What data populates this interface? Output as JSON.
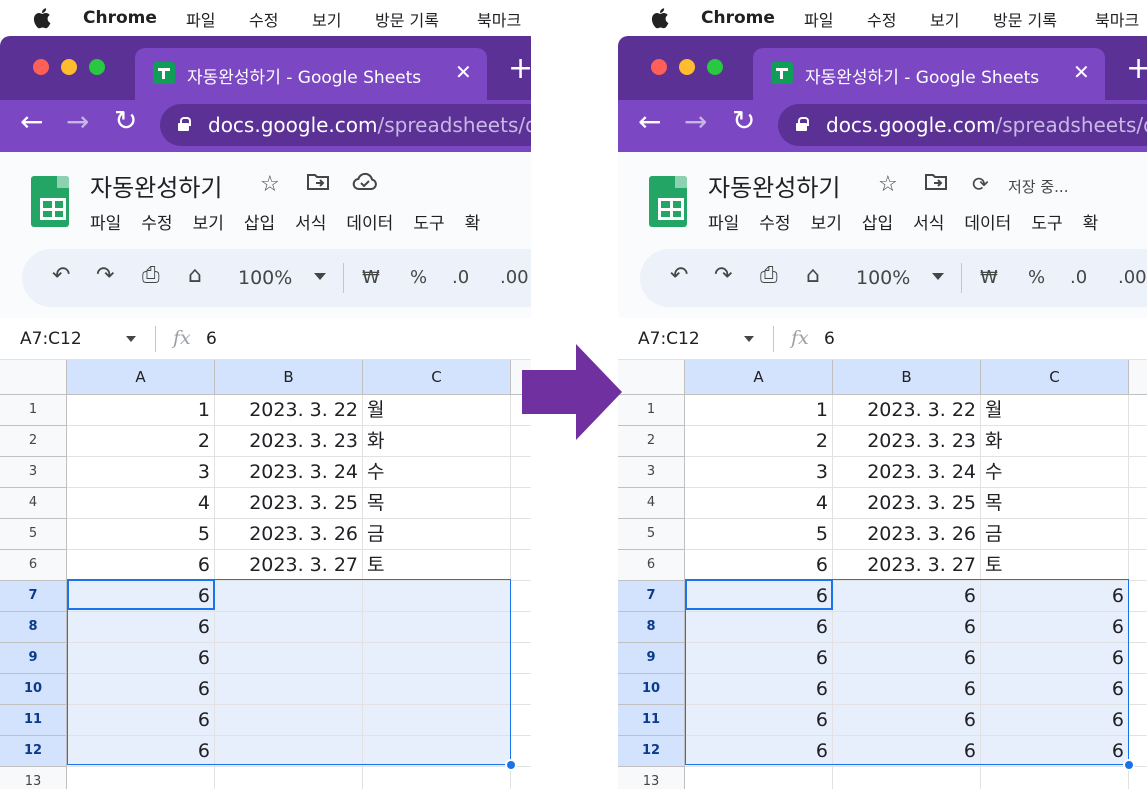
{
  "menubar": {
    "app": "Chrome",
    "items": [
      "파일",
      "수정",
      "보기",
      "방문 기록",
      "북마크"
    ]
  },
  "browser": {
    "tab_title": "자동완성하기 - Google Sheets",
    "tab_close": "✕",
    "new_tab": "+",
    "url_host": "docs.google.com",
    "url_path": "/spreadsheets/d/"
  },
  "sheets": {
    "doc_title": "자동완성하기",
    "menus": [
      "파일",
      "수정",
      "보기",
      "삽입",
      "서식",
      "데이터",
      "도구",
      "확"
    ],
    "zoom": "100%",
    "currency": "₩",
    "percent": "%",
    "dec_decrease": ".0",
    "dec_increase": ".00",
    "saving_status": "저장 중..."
  },
  "formula_bar": {
    "name_box": "A7:C12",
    "fx": "fx",
    "value": "6"
  },
  "grid": {
    "columns": [
      "A",
      "B",
      "C",
      ""
    ],
    "row_numbers": [
      "1",
      "2",
      "3",
      "4",
      "5",
      "6",
      "7",
      "8",
      "9",
      "10",
      "11",
      "12",
      "13"
    ]
  },
  "before": {
    "rows": [
      [
        "1",
        "2023. 3. 22",
        "월"
      ],
      [
        "2",
        "2023. 3. 23",
        "화"
      ],
      [
        "3",
        "2023. 3. 24",
        "수"
      ],
      [
        "4",
        "2023. 3. 25",
        "목"
      ],
      [
        "5",
        "2023. 3. 26",
        "금"
      ],
      [
        "6",
        "2023. 3. 27",
        "토"
      ],
      [
        "6",
        "",
        ""
      ],
      [
        "6",
        "",
        ""
      ],
      [
        "6",
        "",
        ""
      ],
      [
        "6",
        "",
        ""
      ],
      [
        "6",
        "",
        ""
      ],
      [
        "6",
        "",
        ""
      ],
      [
        "",
        "",
        ""
      ]
    ]
  },
  "after": {
    "rows": [
      [
        "1",
        "2023. 3. 22",
        "월"
      ],
      [
        "2",
        "2023. 3. 23",
        "화"
      ],
      [
        "3",
        "2023. 3. 24",
        "수"
      ],
      [
        "4",
        "2023. 3. 25",
        "목"
      ],
      [
        "5",
        "2023. 3. 26",
        "금"
      ],
      [
        "6",
        "2023. 3. 27",
        "토"
      ],
      [
        "6",
        "6",
        "6"
      ],
      [
        "6",
        "6",
        "6"
      ],
      [
        "6",
        "6",
        "6"
      ],
      [
        "6",
        "6",
        "6"
      ],
      [
        "6",
        "6",
        "6"
      ],
      [
        "6",
        "6",
        "6"
      ],
      [
        "",
        "",
        ""
      ]
    ]
  },
  "colors": {
    "chrome_tabstrip": "#5b3196",
    "chrome_toolbar": "#7b47c2",
    "selection_border": "#1a73e8",
    "selection_fill": "#e8effc",
    "arrow": "#7030a0"
  }
}
